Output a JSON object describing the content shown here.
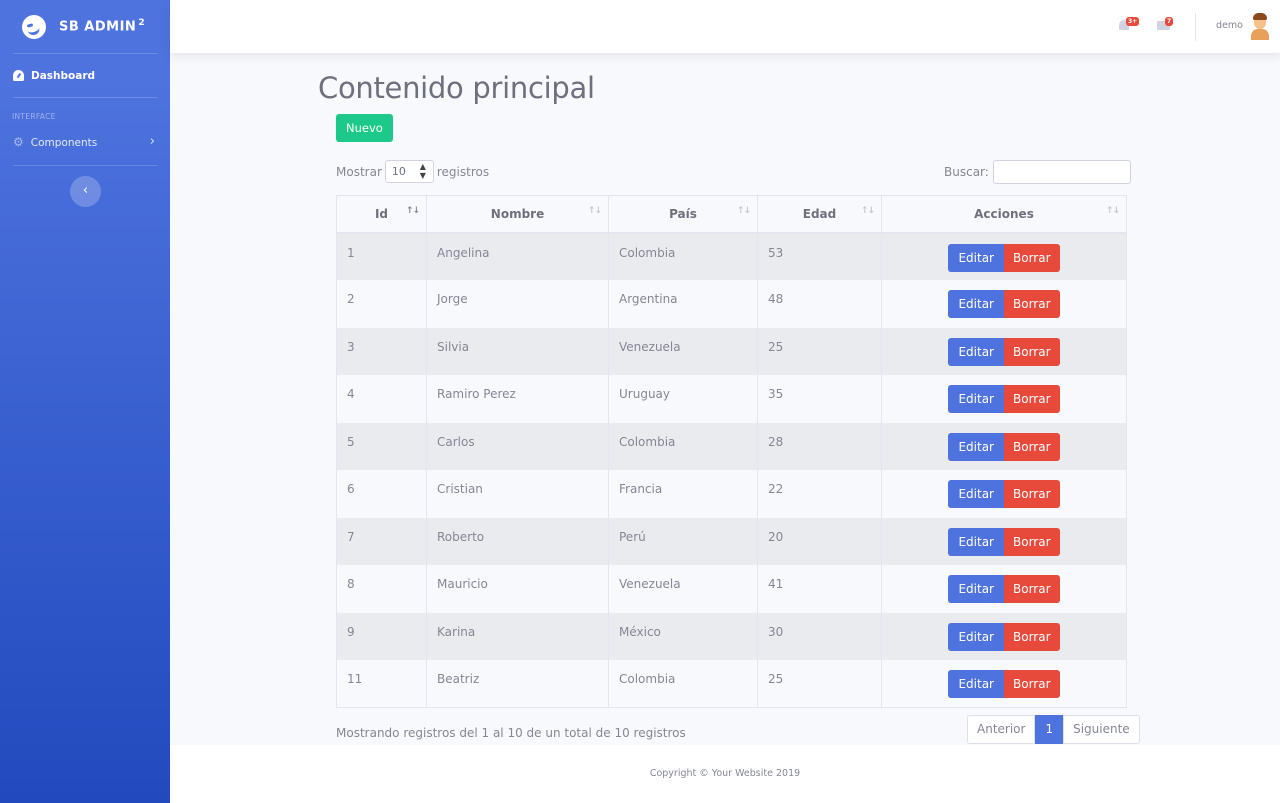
{
  "sidebar": {
    "brand": "SB ADMIN",
    "brand_sup": "2",
    "dashboard_label": "Dashboard",
    "heading": "INTERFACE",
    "components_label": "Components",
    "toggle_icon": "‹"
  },
  "topbar": {
    "alerts_badge": "3+",
    "messages_badge": "7",
    "username": "demo"
  },
  "main": {
    "title": "Contenido principal",
    "new_button": "Nuevo",
    "length_prefix": "Mostrar",
    "length_value": "10",
    "length_suffix": "registros",
    "search_label": "Buscar:",
    "search_value": "",
    "columns": [
      "Id",
      "Nombre",
      "País",
      "Edad",
      "Acciones"
    ],
    "rows": [
      {
        "id": "1",
        "nombre": "Angelina",
        "pais": "Colombia",
        "edad": "53"
      },
      {
        "id": "2",
        "nombre": "Jorge",
        "pais": "Argentina",
        "edad": "48"
      },
      {
        "id": "3",
        "nombre": "Silvia",
        "pais": "Venezuela",
        "edad": "25"
      },
      {
        "id": "4",
        "nombre": "Ramiro Perez",
        "pais": "Uruguay",
        "edad": "35"
      },
      {
        "id": "5",
        "nombre": "Carlos",
        "pais": "Colombia",
        "edad": "28"
      },
      {
        "id": "6",
        "nombre": "Cristian",
        "pais": "Francia",
        "edad": "22"
      },
      {
        "id": "7",
        "nombre": "Roberto",
        "pais": "Perú",
        "edad": "20"
      },
      {
        "id": "8",
        "nombre": "Mauricio",
        "pais": "Venezuela",
        "edad": "41"
      },
      {
        "id": "9",
        "nombre": "Karina",
        "pais": "México",
        "edad": "30"
      },
      {
        "id": "11",
        "nombre": "Beatriz",
        "pais": "Colombia",
        "edad": "25"
      }
    ],
    "edit_label": "Editar",
    "delete_label": "Borrar",
    "info": "Mostrando registros del 1 al 10 de un total de 10 registros",
    "pager": {
      "prev": "Anterior",
      "current": "1",
      "next": "Siguiente"
    }
  },
  "footer": {
    "copyright": "Copyright © Your Website 2019"
  },
  "colors": {
    "primary": "#4e73df",
    "success": "#1cc88a",
    "danger": "#e74a3b"
  }
}
